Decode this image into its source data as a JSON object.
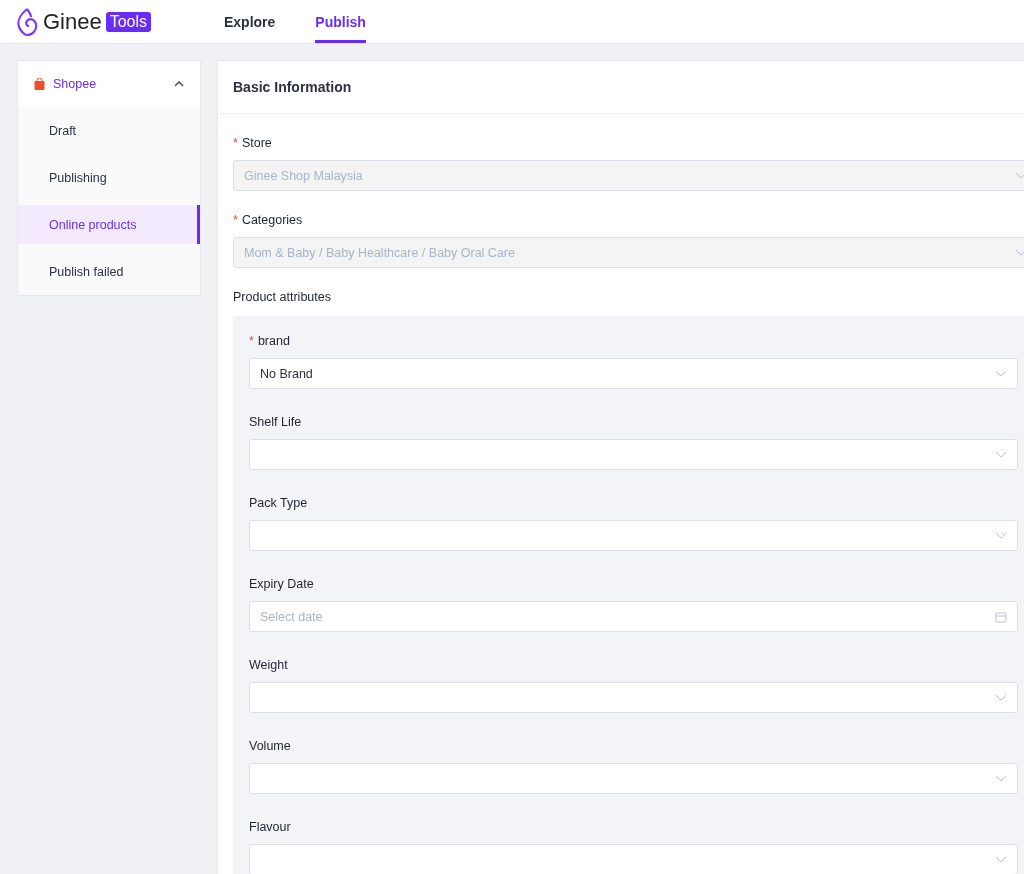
{
  "header": {
    "logo_text": "Ginee",
    "logo_badge": "Tools",
    "tabs": [
      {
        "label": "Explore",
        "selected": false
      },
      {
        "label": "Publish",
        "selected": true
      }
    ]
  },
  "sidebar": {
    "group": {
      "label": "Shopee",
      "expanded": true
    },
    "items": [
      {
        "label": "Draft",
        "selected": false
      },
      {
        "label": "Publishing",
        "selected": false
      },
      {
        "label": "Online products",
        "selected": true
      },
      {
        "label": "Publish failed",
        "selected": false
      }
    ]
  },
  "basic_information": {
    "title": "Basic Information",
    "fields": [
      {
        "label": "Store",
        "required_mark": "*",
        "kind": "select",
        "value": "Ginee Shop Malaysia",
        "disabled": true
      },
      {
        "label": "Categories",
        "required_mark": "*",
        "kind": "select",
        "value": "Mom & Baby / Baby Healthcare / Baby Oral Care",
        "disabled": true
      }
    ]
  },
  "product_attributes": {
    "title": "Product attributes",
    "fields": [
      {
        "label": "brand",
        "required_mark": "*",
        "kind": "select",
        "value": "No Brand"
      },
      {
        "label": "Shelf Life",
        "kind": "select"
      },
      {
        "label": "Pack Type",
        "kind": "select"
      },
      {
        "label": "Expiry Date",
        "kind": "date",
        "placeholder": "Select date"
      },
      {
        "label": "Weight",
        "kind": "select"
      },
      {
        "label": "Volume",
        "kind": "select"
      },
      {
        "label": "Flavour",
        "kind": "select"
      }
    ]
  }
}
